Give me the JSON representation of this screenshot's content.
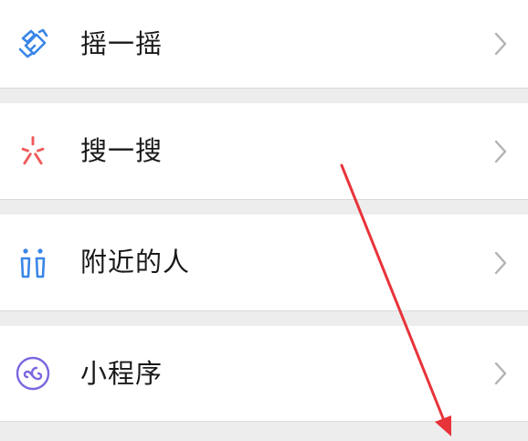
{
  "menu": {
    "items": [
      {
        "label": "摇一摇",
        "icon": "shake-icon"
      },
      {
        "label": "搜一搜",
        "icon": "search-spark-icon"
      },
      {
        "label": "附近的人",
        "icon": "people-nearby-icon"
      },
      {
        "label": "小程序",
        "icon": "mini-program-icon"
      }
    ]
  },
  "colors": {
    "background": "#ededed",
    "row": "#ffffff",
    "text": "#191919",
    "chevron": "#b2b2b2",
    "shake_icon": "#3a86e8",
    "search_icon": "#f05a5a",
    "people_icon": "#3a86e8",
    "mini_program_icon": "#7a67e0",
    "annotation_arrow": "#e8333a"
  }
}
